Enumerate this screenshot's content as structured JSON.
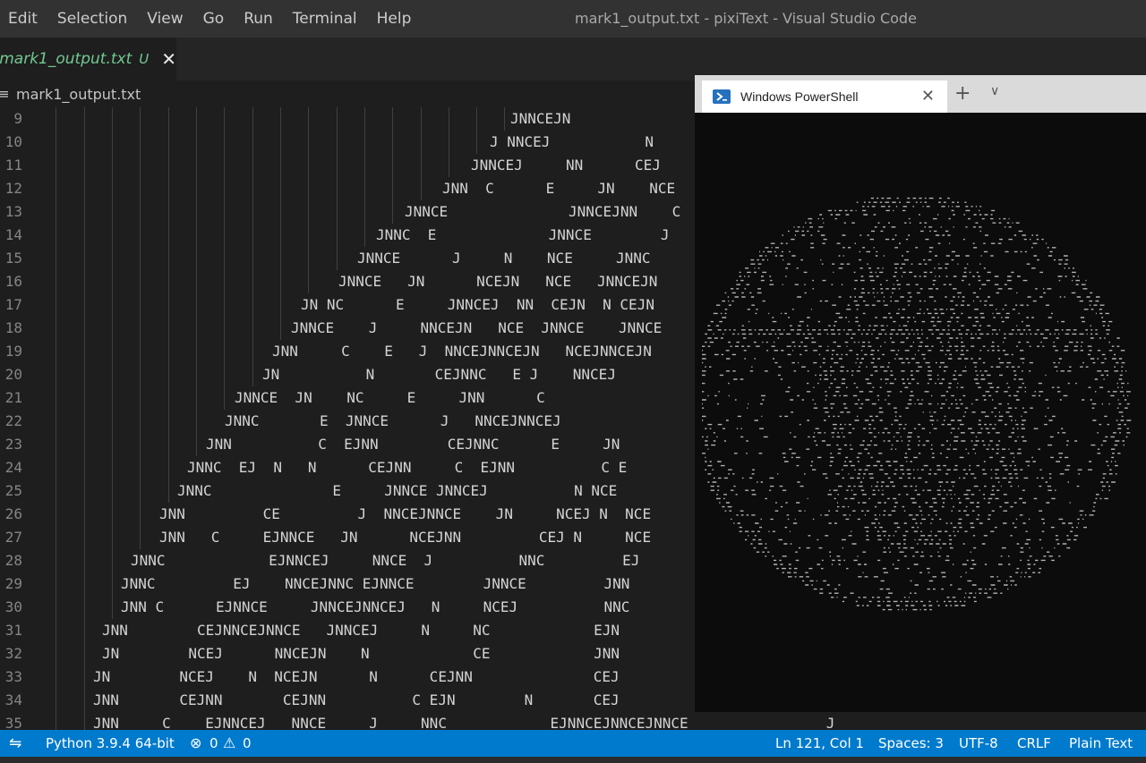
{
  "menu": [
    "Edit",
    "Selection",
    "View",
    "Go",
    "Run",
    "Terminal",
    "Help"
  ],
  "window_title": "mark1_output.txt - pixiText - Visual Studio Code",
  "tab": {
    "label": "mark1_output.txt",
    "status": "U",
    "file_icon": "≡",
    "close_icon": "✕"
  },
  "breadcrumb": {
    "icon": "≡",
    "label": "mark1_output.txt"
  },
  "editor_lines": [
    {
      "num": "9",
      "text": "                                   JNNCEJN"
    },
    {
      "num": "10",
      "text": "                                 J NNCEJ           N"
    },
    {
      "num": "11",
      "text": "                               JNNCEJ     NN      CEJ"
    },
    {
      "num": "12",
      "text": "                            JNN  C      E     JN    NCE"
    },
    {
      "num": "13",
      "text": "                        JNNCE              JNNCEJNN    C"
    },
    {
      "num": "14",
      "text": "                     JNNC  E             JNNCE        J"
    },
    {
      "num": "15",
      "text": "                   JNNCE      J     N    NCE     JNNC"
    },
    {
      "num": "16",
      "text": "                 JNNCE   JN      NCEJN   NCE   JNNCEJN"
    },
    {
      "num": "17",
      "text": "             JN NC      E     JNNCEJ  NN  CEJN  N CEJN"
    },
    {
      "num": "18",
      "text": "               JNNCE    J     NNCEJN   NCE  JNNCE    JNNCE"
    },
    {
      "num": "19",
      "text": "            JNN     C    E   J  NNCEJNNCEJN   NCEJNNCEJN"
    },
    {
      "num": "20",
      "text": "           JN          N       CEJNNC   E J    NNCEJ"
    },
    {
      "num": "21",
      "text": "        JNNCE  JN    NC     E     JNN      C"
    },
    {
      "num": "22",
      "text": "       JNNC       E  JNNCE      J   NNCEJNNCEJ"
    },
    {
      "num": "23",
      "text": "     JNN          C  EJNN        CEJNNC      E     JN"
    },
    {
      "num": "24",
      "text": "   JNNC  EJ  N   N      CEJNN     C  EJNN          C E"
    },
    {
      "num": "25",
      "text": "  JNNC              E     JNNCE JNNCEJ          N NCE"
    },
    {
      "num": "26",
      "text": "JNN         CE         J  NNCEJNNCE    JN     NCEJ N  NCE"
    },
    {
      "num": "27",
      "text": "JNN   C     EJNNCE   JN      NCEJNN         CEJ N     NCE"
    },
    {
      "num": "28",
      "text": "JNNC            EJNNCEJ     NNCE  J          NNC         EJ"
    },
    {
      "num": "29",
      "text": "JNNC         EJ    NNCEJNNC EJNNCE        JNNCE         JNN"
    },
    {
      "num": "30",
      "text": "JNN C      EJNNCE     JNNCEJNNCEJ   N     NCEJ          NNC"
    },
    {
      "num": "31",
      "text": "JNN        CEJNNCEJNNCE   JNNCEJ     N     NC            EJN"
    },
    {
      "num": "32",
      "text": "JN        NCEJ      NNCEJN    N            CE            JNN"
    },
    {
      "num": "33",
      "text": "JN        NCEJ    N  NCEJN      N      CEJNN              CEJ"
    },
    {
      "num": "34",
      "text": "JNN       CEJNN       CEJNN          C EJN        N       CEJ"
    },
    {
      "num": "35",
      "text": "JNN     C    EJNNCEJ   NNCE     J     NNC            EJNNCEJNNCEJNNCE                J"
    }
  ],
  "powershell": {
    "tab_label": "Windows PowerShell",
    "close_icon": "✕",
    "new_tab_icon": "+",
    "dropdown_icon": "∨"
  },
  "statusbar": {
    "remote_icon": "⇋",
    "python": "Python 3.9.4 64-bit",
    "error_icon": "⊗",
    "errors": "0",
    "warning_icon": "⚠",
    "warnings": "0",
    "position": "Ln 121, Col 1",
    "spaces": "Spaces: 3",
    "encoding": "UTF-8",
    "eol": "CRLF",
    "language": "Plain Text"
  },
  "colors": {
    "editor_bg": "#1e1e1e",
    "statusbar_bg": "#007acc",
    "untracked_green": "#73c991",
    "terminal_bg": "#0c0c0c"
  }
}
